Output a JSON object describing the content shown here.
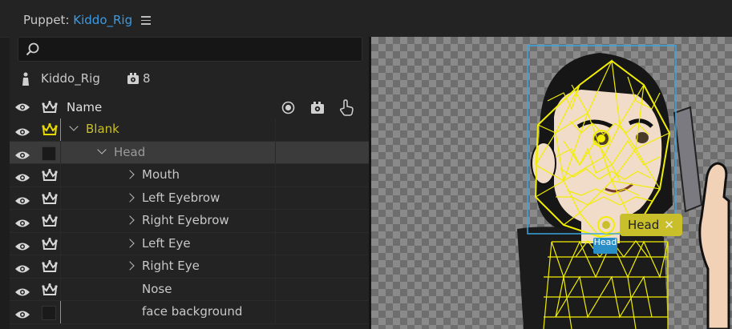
{
  "panel": {
    "title_prefix": "Puppet: ",
    "title_name": "Kiddo_Rig"
  },
  "search": {
    "placeholder": ""
  },
  "puppet": {
    "name": "Kiddo_Rig",
    "camera_count": "8"
  },
  "columns": {
    "name": "Name"
  },
  "layers": [
    {
      "label": "Blank",
      "indent": 0,
      "expand": "down",
      "color": "#c9bf2a",
      "crown": "yellow"
    },
    {
      "label": "Head",
      "indent": 1,
      "expand": "down",
      "color": "#9a9a9a",
      "crown": "box",
      "selected": true
    },
    {
      "label": "Mouth",
      "indent": 2,
      "expand": "right",
      "color": "#c8c8c8",
      "crown": "white"
    },
    {
      "label": "Left Eyebrow",
      "indent": 2,
      "expand": "right",
      "color": "#c8c8c8",
      "crown": "white"
    },
    {
      "label": "Right Eyebrow",
      "indent": 2,
      "expand": "right",
      "color": "#c8c8c8",
      "crown": "white"
    },
    {
      "label": "Left Eye",
      "indent": 2,
      "expand": "right",
      "color": "#c8c8c8",
      "crown": "white"
    },
    {
      "label": "Right Eye",
      "indent": 2,
      "expand": "right",
      "color": "#c8c8c8",
      "crown": "white"
    },
    {
      "label": "Nose",
      "indent": 2,
      "expand": "none",
      "color": "#c8c8c8",
      "crown": "white"
    },
    {
      "label": "face background",
      "indent": 2,
      "expand": "none",
      "color": "#c8c8c8",
      "crown": "box"
    }
  ],
  "canvas": {
    "tag_label": "Head",
    "tag_close": "✕",
    "handle_label": "Head"
  },
  "colors": {
    "accent": "#3b9be5",
    "mesh": "#f2ee00",
    "tag": "#c9bf2a"
  }
}
